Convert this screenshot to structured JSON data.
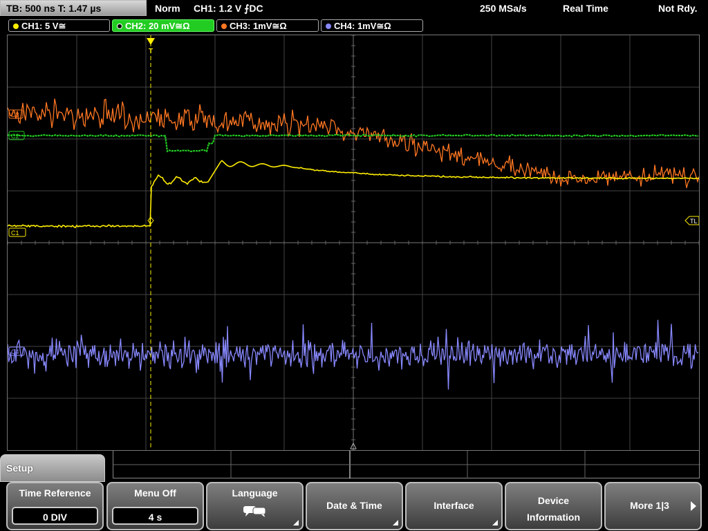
{
  "status": {
    "timebase": "TB: 500 ns   T: 1.47 µs",
    "mode": "Norm",
    "trigger": "CH1: 1.2 V ⨍DC",
    "sample_rate": "250 MSa/s",
    "acq": "Real Time",
    "ready": "Not Rdy."
  },
  "channels": [
    {
      "label": "CH1: 5 V≅",
      "color": "#ffee00",
      "active": false
    },
    {
      "label": "CH2: 20 mV≅Ω",
      "color": "#22cc22",
      "active": true
    },
    {
      "label": "CH3: 1mV≅Ω",
      "color": "#ff7722",
      "active": false
    },
    {
      "label": "CH4: 1mV≅Ω",
      "color": "#8888ff",
      "active": false
    }
  ],
  "markers": {
    "ch3": "C3",
    "ch2": "C2",
    "ch1": "C1",
    "ch4": "C4",
    "trigger_level": "TL",
    "trigger_pos": "T"
  },
  "menu": {
    "title": "Setup",
    "time_reference": {
      "label": "Time Reference",
      "value": "0 DIV"
    },
    "menu_off": {
      "label": "Menu Off",
      "value": "4 s"
    },
    "language": {
      "label": "Language"
    },
    "date_time": {
      "label": "Date & Time"
    },
    "interface": {
      "label": "Interface"
    },
    "device_info": {
      "line1": "Device",
      "line2": "Information"
    },
    "more": {
      "label": "More 1|3"
    }
  },
  "colors": {
    "ch1": "#ffee00",
    "ch2": "#22cc22",
    "ch3": "#ff7722",
    "ch4": "#8888ff",
    "grid": "#555555"
  }
}
